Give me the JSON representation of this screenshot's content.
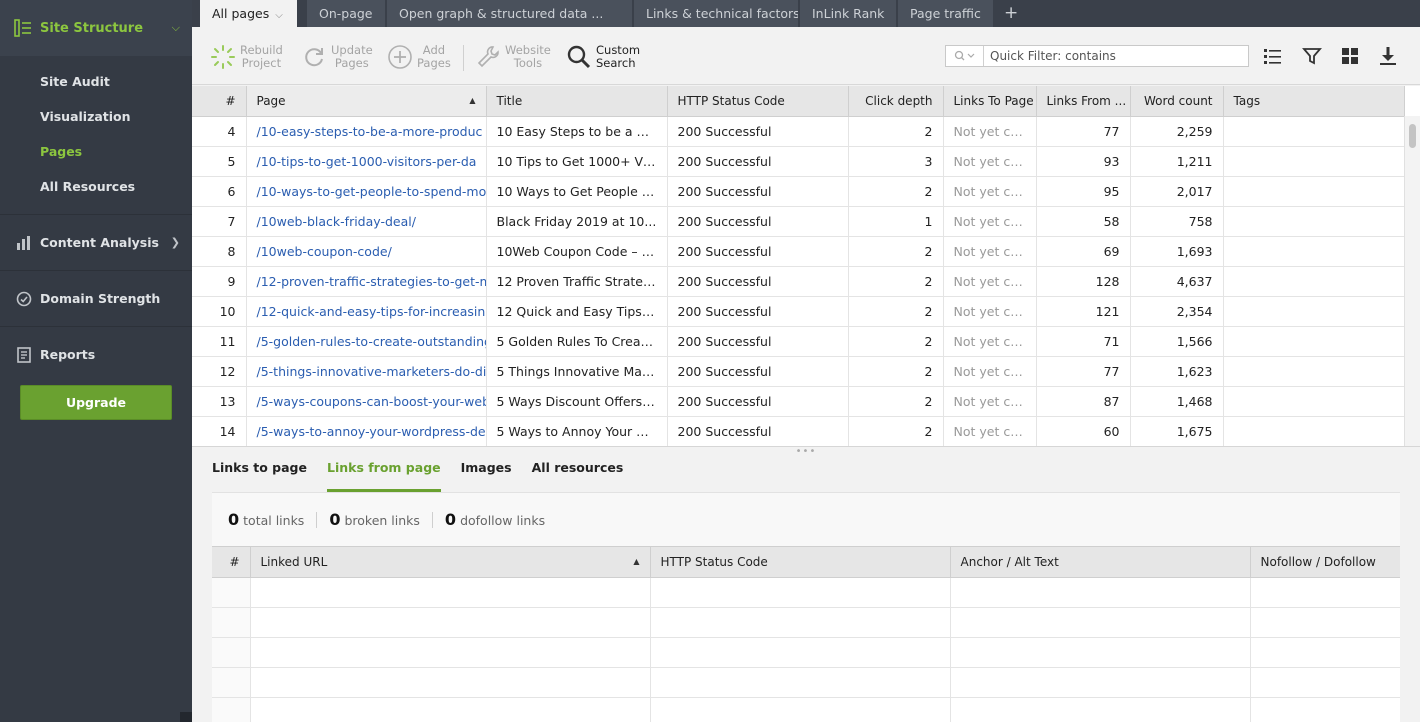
{
  "sidebar": {
    "header": "Site Structure",
    "sub_items": [
      {
        "label": "Site Audit",
        "active": false
      },
      {
        "label": "Visualization",
        "active": false
      },
      {
        "label": "Pages",
        "active": true
      },
      {
        "label": "All Resources",
        "active": false
      }
    ],
    "sections": [
      {
        "label": "Content Analysis"
      },
      {
        "label": "Domain Strength"
      },
      {
        "label": "Reports"
      }
    ],
    "upgrade_label": "Upgrade"
  },
  "tabs": [
    {
      "label": "All pages",
      "active": true
    },
    {
      "label": "On-page",
      "active": false
    },
    {
      "label": "Open graph & structured data ...",
      "active": false
    },
    {
      "label": "Links & technical factors",
      "active": false
    },
    {
      "label": "InLink Rank",
      "active": false
    },
    {
      "label": "Page traffic",
      "active": false
    }
  ],
  "toolbar": {
    "rebuild": [
      "Rebuild",
      "Project"
    ],
    "update": [
      "Update",
      "Pages"
    ],
    "add": [
      "Add",
      "Pages"
    ],
    "website_tools": [
      "Website",
      "Tools"
    ],
    "custom_search": [
      "Custom",
      "Search"
    ],
    "quick_filter_placeholder": "Quick Filter: contains"
  },
  "table": {
    "columns": [
      "#",
      "Page",
      "Title",
      "HTTP Status Code",
      "Click depth",
      "Links To Page",
      "Links From ...",
      "Word count",
      "Tags"
    ],
    "rows": [
      {
        "idx": "4",
        "page": "/10-easy-steps-to-be-a-more-produc",
        "title": "10 Easy Steps to be a Mo...",
        "status": "200 Successful",
        "depth": "2",
        "to": "Not yet ch...",
        "from": "77",
        "words": "2,259"
      },
      {
        "idx": "5",
        "page": "/10-tips-to-get-1000-visitors-per-da",
        "title": "10 Tips to Get 1000+ Vi...",
        "status": "200 Successful",
        "depth": "3",
        "to": "Not yet ch...",
        "from": "93",
        "words": "1,211"
      },
      {
        "idx": "6",
        "page": "/10-ways-to-get-people-to-spend-mo",
        "title": "10 Ways to Get People to...",
        "status": "200 Successful",
        "depth": "2",
        "to": "Not yet ch...",
        "from": "95",
        "words": "2,017"
      },
      {
        "idx": "7",
        "page": "/10web-black-friday-deal/",
        "title": "Black Friday 2019 at 10...",
        "status": "200 Successful",
        "depth": "1",
        "to": "Not yet ch...",
        "from": "58",
        "words": "758"
      },
      {
        "idx": "8",
        "page": "/10web-coupon-code/",
        "title": "10Web Coupon Code – 2...",
        "status": "200 Successful",
        "depth": "2",
        "to": "Not yet ch...",
        "from": "69",
        "words": "1,693"
      },
      {
        "idx": "9",
        "page": "/12-proven-traffic-strategies-to-get-m",
        "title": "12 Proven Traffic Strategi...",
        "status": "200 Successful",
        "depth": "2",
        "to": "Not yet ch...",
        "from": "128",
        "words": "4,637"
      },
      {
        "idx": "10",
        "page": "/12-quick-and-easy-tips-for-increasin",
        "title": "12 Quick and Easy Tips f...",
        "status": "200 Successful",
        "depth": "2",
        "to": "Not yet ch...",
        "from": "121",
        "words": "2,354"
      },
      {
        "idx": "11",
        "page": "/5-golden-rules-to-create-outstanding",
        "title": "5 Golden Rules To Creat...",
        "status": "200 Successful",
        "depth": "2",
        "to": "Not yet ch...",
        "from": "71",
        "words": "1,566"
      },
      {
        "idx": "12",
        "page": "/5-things-innovative-marketers-do-dif",
        "title": "5 Things Innovative Mark...",
        "status": "200 Successful",
        "depth": "2",
        "to": "Not yet ch...",
        "from": "77",
        "words": "1,623"
      },
      {
        "idx": "13",
        "page": "/5-ways-coupons-can-boost-your-web",
        "title": "5 Ways Discount Offers C...",
        "status": "200 Successful",
        "depth": "2",
        "to": "Not yet ch...",
        "from": "87",
        "words": "1,468"
      },
      {
        "idx": "14",
        "page": "/5-ways-to-annoy-your-wordpress-de",
        "title": "5 Ways to Annoy Your Wo...",
        "status": "200 Successful",
        "depth": "2",
        "to": "Not yet ch...",
        "from": "60",
        "words": "1,675"
      }
    ]
  },
  "bottom_tabs": [
    {
      "label": "Links to page",
      "active": false
    },
    {
      "label": "Links from page",
      "active": true
    },
    {
      "label": "Images",
      "active": false
    },
    {
      "label": "All resources",
      "active": false
    }
  ],
  "summary": [
    {
      "count": "0",
      "label": "total links"
    },
    {
      "count": "0",
      "label": "broken links"
    },
    {
      "count": "0",
      "label": "dofollow links"
    }
  ],
  "links_table": {
    "columns": [
      "#",
      "Linked URL",
      "HTTP Status Code",
      "Anchor / Alt Text",
      "Nofollow / Dofollow"
    ]
  },
  "colors": {
    "accent": "#8cc63f",
    "accent_dark": "#6aa130",
    "link": "#2a5db0",
    "sidebar_bg": "#343a44"
  }
}
